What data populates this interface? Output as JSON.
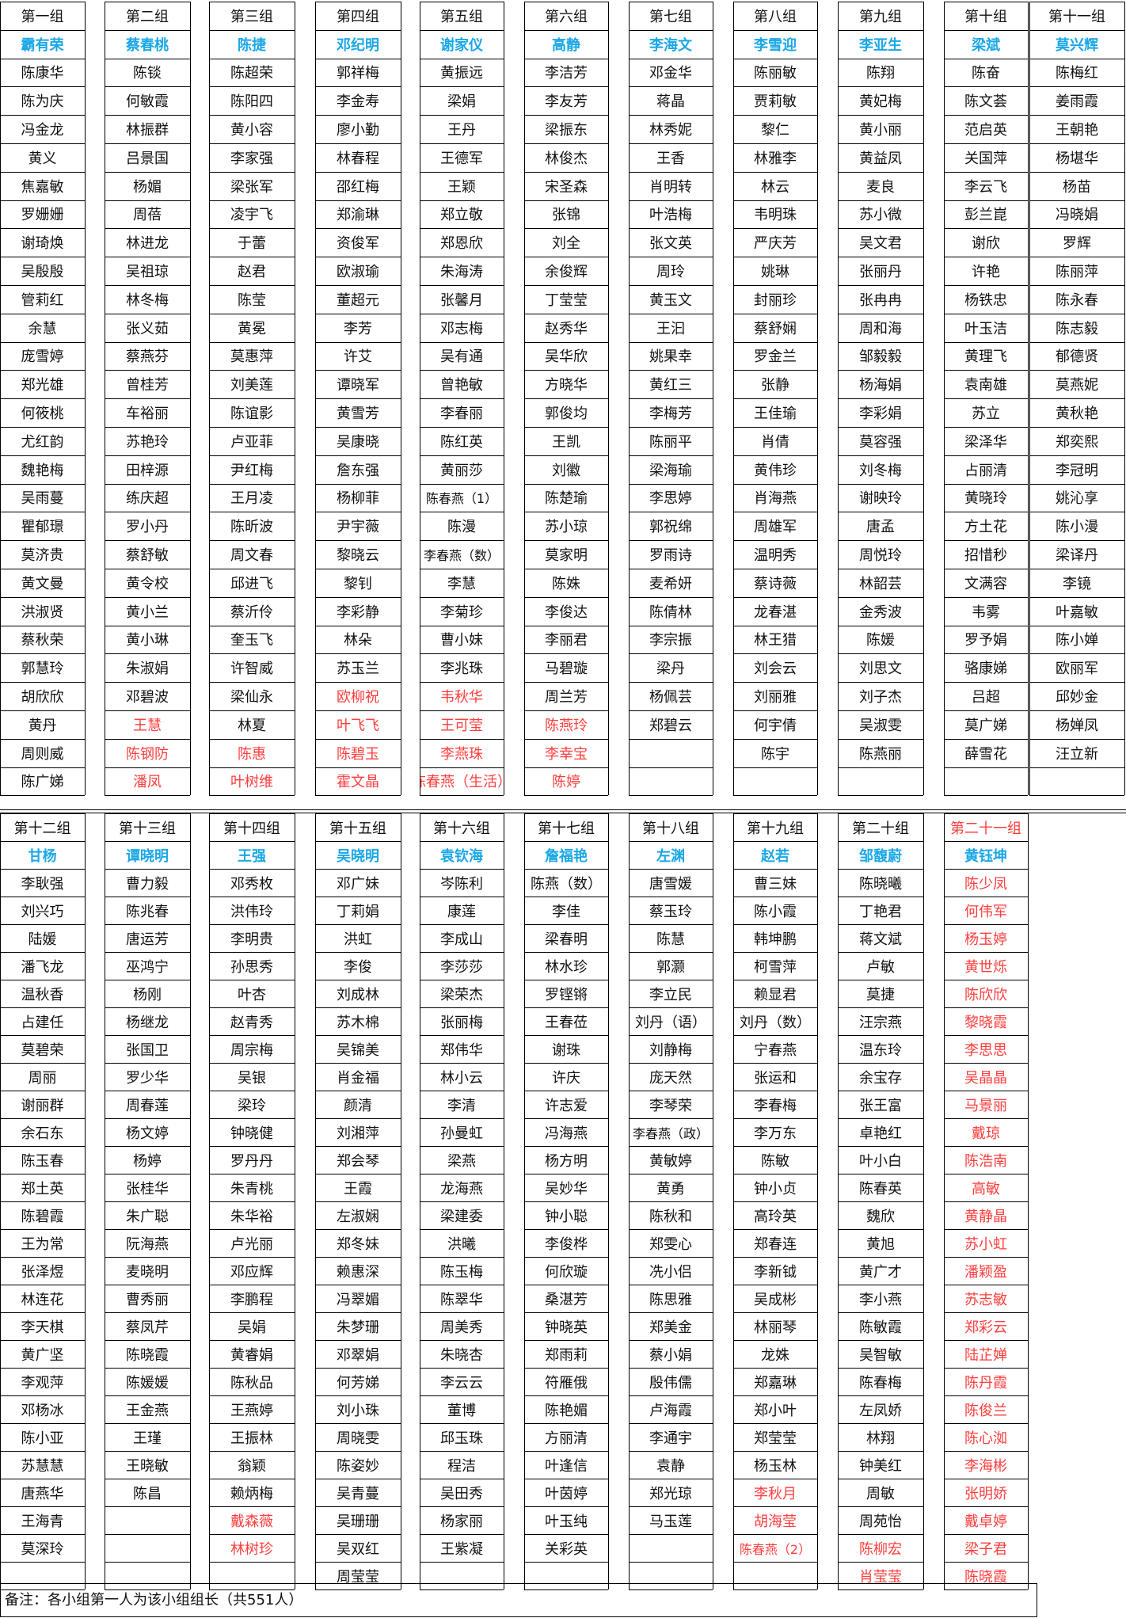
{
  "sections": [
    {
      "groups": [
        {
          "header": "第一组",
          "leader": "霸有荣",
          "members": [
            "陈康华",
            "陈为庆",
            "冯金龙",
            "黄义",
            "焦嘉敏",
            "罗姗姗",
            "谢琦焕",
            "吴殷殷",
            "管莉红",
            "余慧",
            "庞雪婷",
            "郑光雄",
            "何筱桃",
            "尤红韵",
            "魏艳梅",
            "吴雨蔓",
            "瞿郁璟",
            "莫济贵",
            "黄文曼",
            "洪淑贤",
            "蔡秋荣",
            "郭慧玲",
            "胡欣欣",
            "黄丹",
            "周则威",
            "陈广娣"
          ],
          "red_from": 99
        },
        {
          "header": "第二组",
          "leader": "蔡春桃",
          "members": [
            "陈锬",
            "何敏霞",
            "林振群",
            "吕景国",
            "杨媚",
            "周蓓",
            "林进龙",
            "吴祖琼",
            "林冬梅",
            "张义茹",
            "蔡燕芬",
            "曾桂芳",
            "车裕丽",
            "苏艳玲",
            "田梓源",
            "练庆超",
            "罗小丹",
            "蔡舒敏",
            "黄令校",
            "黄小兰",
            "黄小琳",
            "朱淑娟",
            "邓碧波",
            "王慧",
            "陈钢防",
            "潘凤"
          ],
          "red_from": 23
        },
        {
          "header": "第三组",
          "leader": "陈捷",
          "members": [
            "陈超荣",
            "陈阳四",
            "黄小容",
            "李家强",
            "梁张军",
            "凌宇飞",
            "于蕾",
            "赵君",
            "陈莹",
            "黄冕",
            "莫惠萍",
            "刘美莲",
            "陈谊影",
            "卢亚菲",
            "尹红梅",
            "王月凌",
            "陈昕波",
            "周文春",
            "邱进飞",
            "蔡沂伶",
            "奎玉飞",
            "许智威",
            "梁仙永",
            "林夏",
            "陈惠",
            "叶树维"
          ],
          "red_from": 24
        },
        {
          "header": "第四组",
          "leader": "邓纪明",
          "members": [
            "郭祥梅",
            "李金寿",
            "廖小勤",
            "林春程",
            "邵红梅",
            "郑渝琳",
            "资俊军",
            "欧淑瑜",
            "董超元",
            "李芳",
            "许艾",
            "谭晓军",
            "黄雪芳",
            "吴康晓",
            "詹东强",
            "杨柳菲",
            "尹宇薇",
            "黎晓云",
            "黎钊",
            "李彩静",
            "林朵",
            "苏玉兰",
            "欧柳祝",
            "叶飞飞",
            "陈碧玉",
            "霍文晶"
          ],
          "red_from": 22
        },
        {
          "header": "第五组",
          "leader": "谢家仪",
          "members": [
            "黄振远",
            "梁娟",
            "王丹",
            "王德军",
            "王颖",
            "郑立敬",
            "郑恩欣",
            "朱海涛",
            "张馨月",
            "邓志梅",
            "吴有通",
            "曾艳敏",
            "李春丽",
            "陈红英",
            "黄丽莎",
            "陈春燕（1）",
            "陈漫",
            "李春燕（数）",
            "李慧",
            "李菊珍",
            "曹小妹",
            "李兆珠",
            "韦秋华",
            "王可莹",
            "李燕珠",
            "陈春燕（生活）"
          ],
          "red_from": 22
        },
        {
          "header": "第六组",
          "leader": "高静",
          "members": [
            "李洁芳",
            "李友芳",
            "梁振东",
            "林俊杰",
            "宋圣森",
            "张锦",
            "刘全",
            "余俊辉",
            "丁莹莹",
            "赵秀华",
            "吴华欣",
            "方晓华",
            "郭俊均",
            "王凯",
            "刘徽",
            "陈楚瑜",
            "苏小琼",
            "莫家明",
            "陈姝",
            "李俊达",
            "李丽君",
            "马碧璇",
            "周兰芳",
            "陈燕玲",
            "李幸宝",
            "陈婷"
          ],
          "red_from": 23
        },
        {
          "header": "第七组",
          "leader": "李海文",
          "members": [
            "邓金华",
            "蒋晶",
            "林秀妮",
            "王香",
            "肖明转",
            "叶浩梅",
            "张文英",
            "周玲",
            "黄玉文",
            "王汩",
            "姚果幸",
            "黄红三",
            "李梅芳",
            "陈丽平",
            "梁海瑜",
            "李思婷",
            "郭祝绵",
            "罗雨诗",
            "麦希妍",
            "陈倩林",
            "李宗振",
            "梁丹",
            "杨佩芸",
            "郑碧云"
          ],
          "red_from": 99
        },
        {
          "header": "第八组",
          "leader": "李雪迎",
          "members": [
            "陈丽敏",
            "贾莉敏",
            "黎仁",
            "林雅李",
            "林云",
            "韦明珠",
            "严庆芳",
            "姚琳",
            "封丽珍",
            "蔡舒娴",
            "罗金兰",
            "张静",
            "王佳瑜",
            "肖倩",
            "黄伟珍",
            "肖海燕",
            "周雄军",
            "温明秀",
            "蔡诗薇",
            "龙春湛",
            "林王猎",
            "刘会云",
            "刘丽雅",
            "何宇倩",
            "陈宇"
          ],
          "red_from": 99
        },
        {
          "header": "第九组",
          "leader": "李亚生",
          "members": [
            "陈翔",
            "黄妃梅",
            "黄小丽",
            "黄益凤",
            "麦良",
            "苏小微",
            "吴文君",
            "张丽丹",
            "张冉冉",
            "周和海",
            "邹毅毅",
            "杨海娟",
            "李彩娟",
            "莫容强",
            "刘冬梅",
            "谢映玲",
            "唐孟",
            "周悦玲",
            "林韶芸",
            "金秀波",
            "陈媛",
            "刘思文",
            "刘子杰",
            "吴淑雯",
            "陈燕丽"
          ],
          "red_from": 99
        },
        {
          "header": "第十组",
          "leader": "梁斌",
          "members": [
            "陈奋",
            "陈文荟",
            "范启英",
            "关国萍",
            "李云飞",
            "彭兰崑",
            "谢欣",
            "许艳",
            "杨铁忠",
            "叶玉洁",
            "黄理飞",
            "袁南雄",
            "苏立",
            "梁泽华",
            "占丽清",
            "黄晓玲",
            "方土花",
            "招惜秒",
            "文满容",
            "韦雾",
            "罗予娟",
            "骆康娣",
            "吕超",
            "莫广娣",
            "薛雪花"
          ],
          "red_from": 99
        },
        {
          "header": "第十一组",
          "leader": "莫兴辉",
          "members": [
            "陈梅红",
            "姜雨霞",
            "王朝艳",
            "杨堪华",
            "杨苗",
            "冯晓娟",
            "罗辉",
            "陈丽萍",
            "陈永春",
            "陈志毅",
            "郁德贤",
            "莫燕妮",
            "黄秋艳",
            "郑奕熙",
            "李冠明",
            "姚沁享",
            "陈小漫",
            "梁译丹",
            "李镜",
            "叶嘉敏",
            "陈小婵",
            "欧丽军",
            "邱妙金",
            "杨婵凤",
            "汪立新"
          ],
          "red_from": 99
        }
      ]
    },
    {
      "groups": [
        {
          "header": "第十二组",
          "leader": "甘杨",
          "members": [
            "李耿强",
            "刘兴巧",
            "陆媛",
            "潘飞龙",
            "温秋香",
            "占建任",
            "莫碧荣",
            "周丽",
            "谢丽群",
            "余石东",
            "陈玉春",
            "郑土英",
            "陈碧霞",
            "王为常",
            "张泽煜",
            "林连花",
            "李天棋",
            "黄广坚",
            "李观萍",
            "邓杨冰",
            "陈小亚",
            "苏慧慧",
            "唐燕华",
            "王海青",
            "莫深玲"
          ],
          "red_from": 99
        },
        {
          "header": "第十三组",
          "leader": "谭晓明",
          "members": [
            "曹力毅",
            "陈兆春",
            "唐运芳",
            "巫鸿宁",
            "杨刚",
            "杨继龙",
            "张国卫",
            "罗少华",
            "周春莲",
            "杨文婷",
            "杨婷",
            "张桂华",
            "朱广聪",
            "阮海燕",
            "麦晓明",
            "曹秀丽",
            "蔡凤芹",
            "陈晓霞",
            "陈媛媛",
            "王金燕",
            "王瑾",
            "王晓敏",
            "陈昌"
          ],
          "red_from": 99
        },
        {
          "header": "第十四组",
          "leader": "王强",
          "members": [
            "邓秀枚",
            "洪伟玲",
            "李明贵",
            "孙思秀",
            "叶杏",
            "赵青秀",
            "周宗梅",
            "吴银",
            "梁玲",
            "钟晓健",
            "罗丹丹",
            "朱青桃",
            "朱华裕",
            "卢光丽",
            "邓应辉",
            "李鹏程",
            "吴娟",
            "黄睿娟",
            "陈秋品",
            "王燕婷",
            "王振林",
            "翁颖",
            "赖炳梅",
            "戴森薇",
            "林树珍"
          ],
          "red_from": 23
        },
        {
          "header": "第十五组",
          "leader": "吴晓明",
          "members": [
            "邓广妹",
            "丁莉娟",
            "洪虹",
            "李俊",
            "刘成林",
            "苏木棉",
            "吴锦美",
            "肖金福",
            "颜清",
            "刘湘萍",
            "郑会琴",
            "王霞",
            "左淑娴",
            "郑冬妹",
            "赖惠深",
            "冯翠媚",
            "朱梦珊",
            "邓翠娟",
            "何芳娣",
            "刘小珠",
            "周晓雯",
            "陈姿妙",
            "吴青蔓",
            "吴珊珊",
            "吴双红",
            "周莹莹"
          ],
          "red_from": 99
        },
        {
          "header": "第十六组",
          "leader": "袁钦海",
          "members": [
            "岑陈利",
            "康莲",
            "李成山",
            "李莎莎",
            "梁荣杰",
            "张丽梅",
            "郑伟华",
            "林小云",
            "李清",
            "孙曼虹",
            "梁燕",
            "龙海燕",
            "梁建委",
            "洪曦",
            "陈玉梅",
            "陈翠华",
            "周美秀",
            "朱晓杏",
            "李云云",
            "董博",
            "邱玉珠",
            "程洁",
            "吴田秀",
            "杨家丽",
            "王紫凝"
          ],
          "red_from": 99
        },
        {
          "header": "第十七组",
          "leader": "詹福艳",
          "members": [
            "陈燕（数）",
            "李佳",
            "梁春明",
            "林水珍",
            "罗铿锵",
            "王春莅",
            "谢珠",
            "许庆",
            "许志爱",
            "冯海燕",
            "杨方明",
            "吴妙华",
            "钟小聪",
            "李俊桦",
            "何欣璇",
            "桑湛芳",
            "钟晓英",
            "郑雨莉",
            "符雁俄",
            "陈艳媚",
            "方丽清",
            "叶逢信",
            "叶茵婷",
            "叶玉纯",
            "关彩英"
          ],
          "red_from": 99
        },
        {
          "header": "第十八组",
          "leader": "左渊",
          "members": [
            "唐雪媛",
            "蔡玉玲",
            "陈慧",
            "郭灏",
            "李立民",
            "刘丹（语）",
            "刘静梅",
            "庞天然",
            "李琴荣",
            "李春燕（政）",
            "黄敏婷",
            "黄勇",
            "陈秋和",
            "郑雯心",
            "冼小侣",
            "陈思雅",
            "郑美金",
            "蔡小娟",
            "殷伟儒",
            "卢海霞",
            "李通宇",
            "袁静",
            "郑光琼",
            "马玉莲"
          ],
          "red_from": 99
        },
        {
          "header": "第十九组",
          "leader": "赵若",
          "members": [
            "曹三妹",
            "陈小霞",
            "韩坤鹏",
            "柯雪萍",
            "赖显君",
            "刘丹（数）",
            "宁春燕",
            "张运和",
            "李春梅",
            "李万东",
            "陈敏",
            "钟小贞",
            "高玲英",
            "郑春连",
            "李新钺",
            "吴成彬",
            "林丽琴",
            "龙姝",
            "郑嘉琳",
            "郑小叶",
            "郑莹莹",
            "杨玉林",
            "李秋月",
            "胡海莹",
            "陈春燕（2）"
          ],
          "red_from": 22
        },
        {
          "header": "第二十组",
          "leader": "邹馥蔚",
          "members": [
            "陈晓曦",
            "丁艳君",
            "蒋文斌",
            "卢敏",
            "莫捷",
            "汪宗燕",
            "温东玲",
            "余宝存",
            "张王富",
            "卓艳红",
            "叶小白",
            "陈春英",
            "魏欣",
            "黄旭",
            "黄广才",
            "李小燕",
            "陈敏霞",
            "吴智敏",
            "陈春梅",
            "左凤娇",
            "林翔",
            "钟美红",
            "周敏",
            "周苑怡",
            "陈柳宏",
            "肖莹莹"
          ],
          "red_from": 24
        },
        {
          "header": "第二十一组",
          "leader": "黄钰坤",
          "members": [
            "陈少凤",
            "何伟军",
            "杨玉婷",
            "黄世烁",
            "陈欣欣",
            "黎晓霞",
            "李思思",
            "吴晶晶",
            "马景丽",
            "戴琼",
            "陈浩南",
            "高敏",
            "黄静晶",
            "苏小虹",
            "潘颖盈",
            "苏志敏",
            "郑彩云",
            "陆芷婵",
            "陈丹霞",
            "陈俊兰",
            "陈心洳",
            "李海彬",
            "张明娇",
            "戴卓婷",
            "梁子君",
            "陈晓霞"
          ],
          "red_from": 0,
          "header_red": true
        }
      ]
    }
  ],
  "note": "备注：各小组第一人为该小组组长（共551人）",
  "colors": {
    "leader": "#1aa7e6",
    "highlight": "#ff3d3d",
    "text": "#111111",
    "grid": "#000000"
  }
}
